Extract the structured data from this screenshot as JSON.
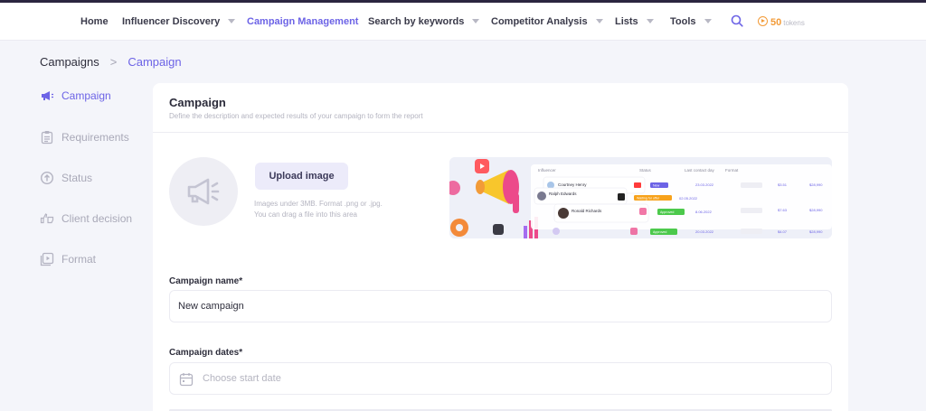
{
  "nav": {
    "items": [
      {
        "label": "Home",
        "dropdown": false,
        "active": false
      },
      {
        "label": "Influencer Discovery",
        "dropdown": true,
        "active": false
      },
      {
        "label": "Campaign Management",
        "dropdown": false,
        "active": true
      },
      {
        "label": "Search by keywords",
        "dropdown": true,
        "active": false
      },
      {
        "label": "Competitor Analysis",
        "dropdown": true,
        "active": false
      },
      {
        "label": "Lists",
        "dropdown": true,
        "active": false
      },
      {
        "label": "Tools",
        "dropdown": true,
        "active": false
      }
    ],
    "search_icon": "search-icon",
    "tokens": {
      "value": "50",
      "label": "tokens",
      "icon": "coin-play-icon"
    }
  },
  "breadcrumb": {
    "root": "Campaigns",
    "separator": ">",
    "current": "Campaign"
  },
  "sidebar": {
    "items": [
      {
        "label": "Campaign",
        "icon": "megaphone-icon",
        "active": true
      },
      {
        "label": "Requirements",
        "icon": "clipboard-icon",
        "active": false
      },
      {
        "label": "Status",
        "icon": "upload-circle-icon",
        "active": false
      },
      {
        "label": "Client decision",
        "icon": "thumbs-icon",
        "active": false
      },
      {
        "label": "Format",
        "icon": "media-icon",
        "active": false
      }
    ]
  },
  "card": {
    "title": "Campaign",
    "subtitle": "Define the description and expected results of your campaign to form the report",
    "upload": {
      "button_label": "Upload image",
      "hint_line1": "Images under 3MB. Format .png or .jpg.",
      "hint_line2": "You can drag a file into this area"
    },
    "preview": {
      "headers": [
        "Influencer",
        "Status",
        "Last contact day",
        "Format"
      ],
      "rows": [
        {
          "name": "Courtney Henry",
          "status": "New",
          "date": "23.03.2022",
          "amount1": "$3.51",
          "amount2": "$28,990"
        },
        {
          "name": "Ralph Edwards",
          "status": "Waiting for offer",
          "date": "02.05.2022"
        },
        {
          "name": "Ronald Richards",
          "status": "Approved",
          "date": "8.06.2022",
          "amount1": "$7.63",
          "amount2": "$28,990"
        },
        {
          "name": "",
          "status": "Approved",
          "date": "20.03.2022",
          "amount1": "$4.07",
          "amount2": "$28,990"
        }
      ],
      "colors": {
        "accent": "#6c63e6",
        "orange": "#f7a21b",
        "green": "#4cc94c",
        "pink": "#ec4a8a",
        "yellow": "#f8c62c"
      }
    },
    "campaign_name": {
      "label": "Campaign name*",
      "value": "New campaign"
    },
    "campaign_dates": {
      "label": "Campaign dates*",
      "placeholder": "Choose start date",
      "icon": "calendar-icon"
    }
  },
  "colors": {
    "accent": "#6c63e6",
    "background": "#f4f5fa",
    "token": "#f29b38"
  }
}
